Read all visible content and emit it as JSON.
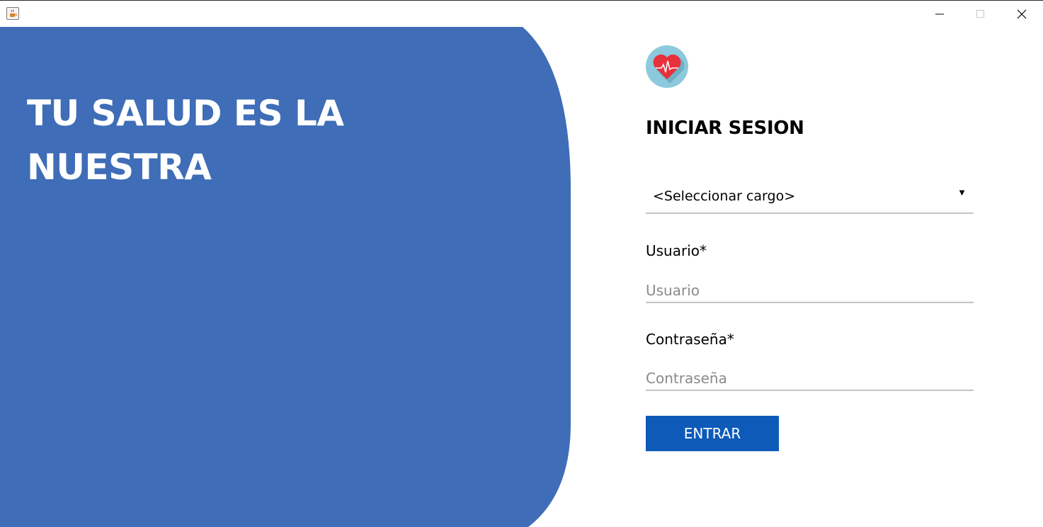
{
  "titlebar": {
    "app_icon": "java-cup-icon",
    "controls": [
      "minimize-icon",
      "maximize-icon",
      "close-icon"
    ]
  },
  "hero": {
    "title": "TU SALUD ES LA NUESTRA",
    "background_color": "#3f6db7"
  },
  "login": {
    "logo_icon": "heart-pulse-icon",
    "title": "INICIAR SESION",
    "role_select": {
      "selected": "<Seleccionar cargo>",
      "arrow": "▼"
    },
    "user": {
      "label": "Usuario*",
      "placeholder": "Usuario",
      "value": ""
    },
    "password": {
      "label": "Contraseña*",
      "placeholder": "Contraseña",
      "value": ""
    },
    "submit_label": "ENTRAR",
    "submit_color": "#0d5ab8"
  }
}
